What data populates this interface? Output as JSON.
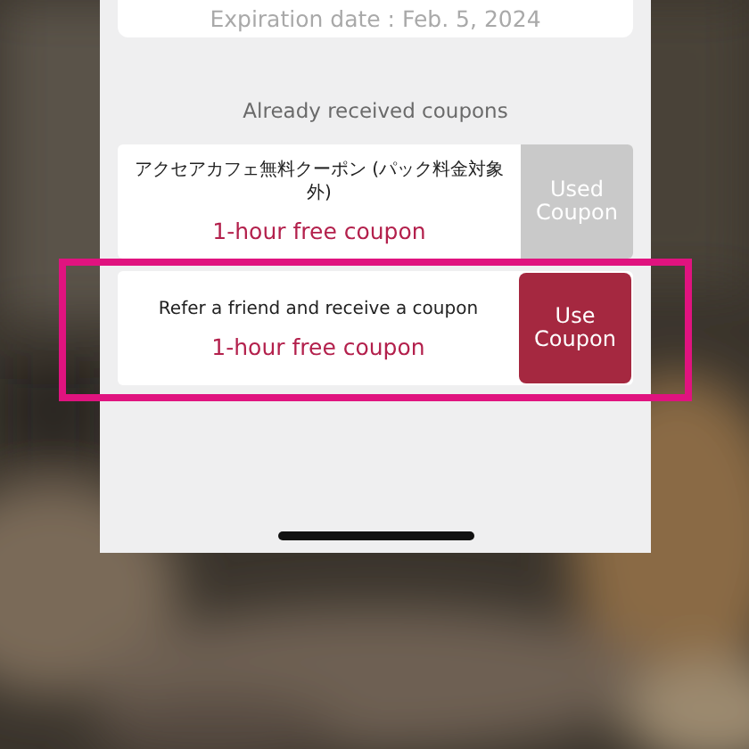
{
  "expiration": "Expiration date : Feb. 5, 2024",
  "section_title": "Already received coupons",
  "coupons": [
    {
      "title": "アクセアカフェ無料クーポン (パック料金対象外)",
      "subtitle": "1-hour free coupon",
      "button": "Used Coupon",
      "used": true,
      "highlighted": false
    },
    {
      "title": "Refer a friend and receive a coupon",
      "subtitle": "1-hour free coupon",
      "button": "Use Coupon",
      "used": false,
      "highlighted": true
    }
  ]
}
